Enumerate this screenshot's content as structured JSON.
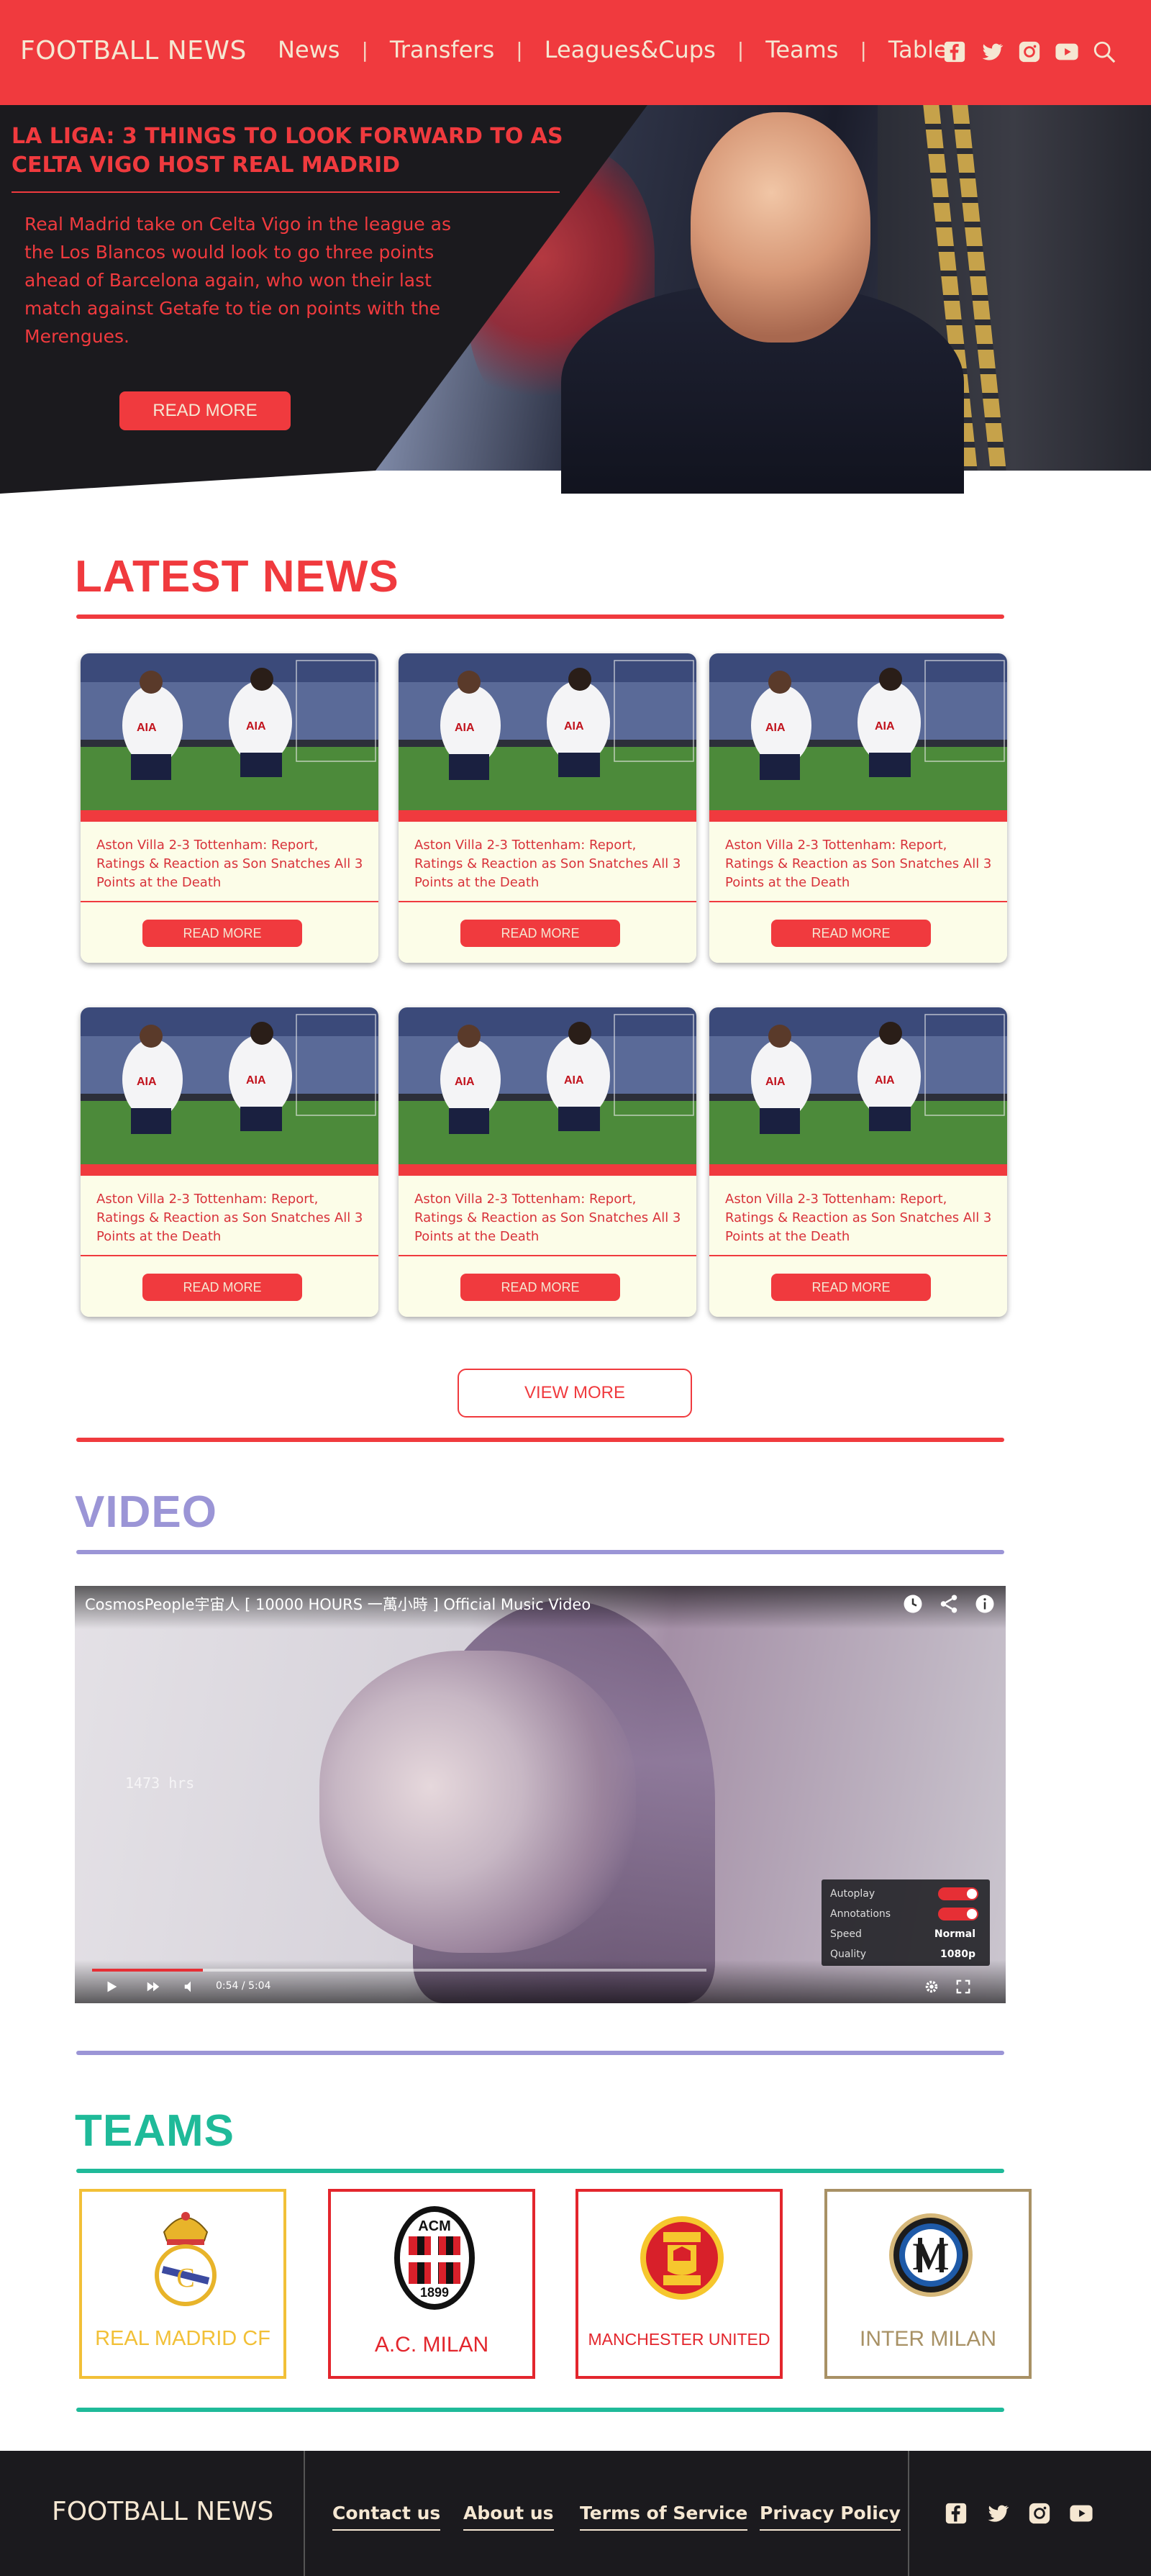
{
  "brand": "FOOTBALL NEWS",
  "nav": {
    "items": [
      "News",
      "Transfers",
      "Leagues&Cups",
      "Teams",
      "Tables"
    ],
    "separator": "|"
  },
  "social": [
    "facebook-icon",
    "twitter-icon",
    "instagram-icon",
    "youtube-icon"
  ],
  "hero": {
    "title": "LA LIGA: 3 THINGS TO LOOK FORWARD TO AS CELTA VIGO HOST  REAL MADRID",
    "text": "Real Madrid take on Celta Vigo in the league as the Los Blancos would look to go three points ahead of Barcelona again, who won their last match against Getafe to tie on points with the Merengues.",
    "button": "READ MORE"
  },
  "latest": {
    "title": "LATEST NEWS",
    "cards": [
      {
        "headline": "Aston Villa 2-3 Tottenham: Report, Ratings & Reaction as Son Snatches All 3 Points at the Death",
        "button": "READ MORE"
      },
      {
        "headline": "Aston Villa 2-3 Tottenham: Report, Ratings & Reaction as Son Snatches All 3 Points at the Death",
        "button": "READ MORE"
      },
      {
        "headline": "Aston Villa 2-3 Tottenham: Report, Ratings & Reaction as Son Snatches All 3 Points at the Death",
        "button": "READ MORE"
      },
      {
        "headline": "Aston Villa 2-3 Tottenham: Report, Ratings & Reaction as Son Snatches All 3 Points at the Death",
        "button": "READ MORE"
      },
      {
        "headline": "Aston Villa 2-3 Tottenham: Report, Ratings & Reaction as Son Snatches All 3 Points at the Death",
        "button": "READ MORE"
      },
      {
        "headline": "Aston Villa 2-3 Tottenham: Report, Ratings & Reaction as Son Snatches All 3 Points at the Death",
        "button": "READ MORE"
      }
    ],
    "view_more": "VIEW MORE"
  },
  "video": {
    "title": "VIDEO",
    "video_title": "CosmosPeople宇宙人 [ 10000 HOURS 一萬小時 ] Official Music Video",
    "overlay_text": "1473 hrs",
    "time": "0:54 / 5:04",
    "progress": 0.18,
    "settings": [
      {
        "label": "Autoplay",
        "value": ""
      },
      {
        "label": "Annotations",
        "value": ""
      },
      {
        "label": "Speed",
        "value": "Normal"
      },
      {
        "label": "Quality",
        "value": "1080p"
      }
    ]
  },
  "teams": {
    "title": "TEAMS",
    "items": [
      {
        "name": "REAL MADRID CF",
        "color": "#f2c037"
      },
      {
        "name": "A.C. MILAN",
        "color": "#e3262d"
      },
      {
        "name": "MANCHESTER UNITED",
        "color": "#e3262d"
      },
      {
        "name": "INTER MILAN",
        "color": "#a89165"
      }
    ],
    "logo_text": {
      "milan_top": "ACM",
      "milan_year": "1899"
    }
  },
  "footer": {
    "brand": "FOOTBALL NEWS",
    "links": [
      "Contact us",
      "About us",
      "Terms of Service",
      "Privacy Policy"
    ]
  },
  "colors": {
    "accent": "#f03a3e",
    "cream": "#f5e7d2",
    "video": "#9b95d6",
    "teams": "#1fba99",
    "dark": "#1b1a1e"
  }
}
